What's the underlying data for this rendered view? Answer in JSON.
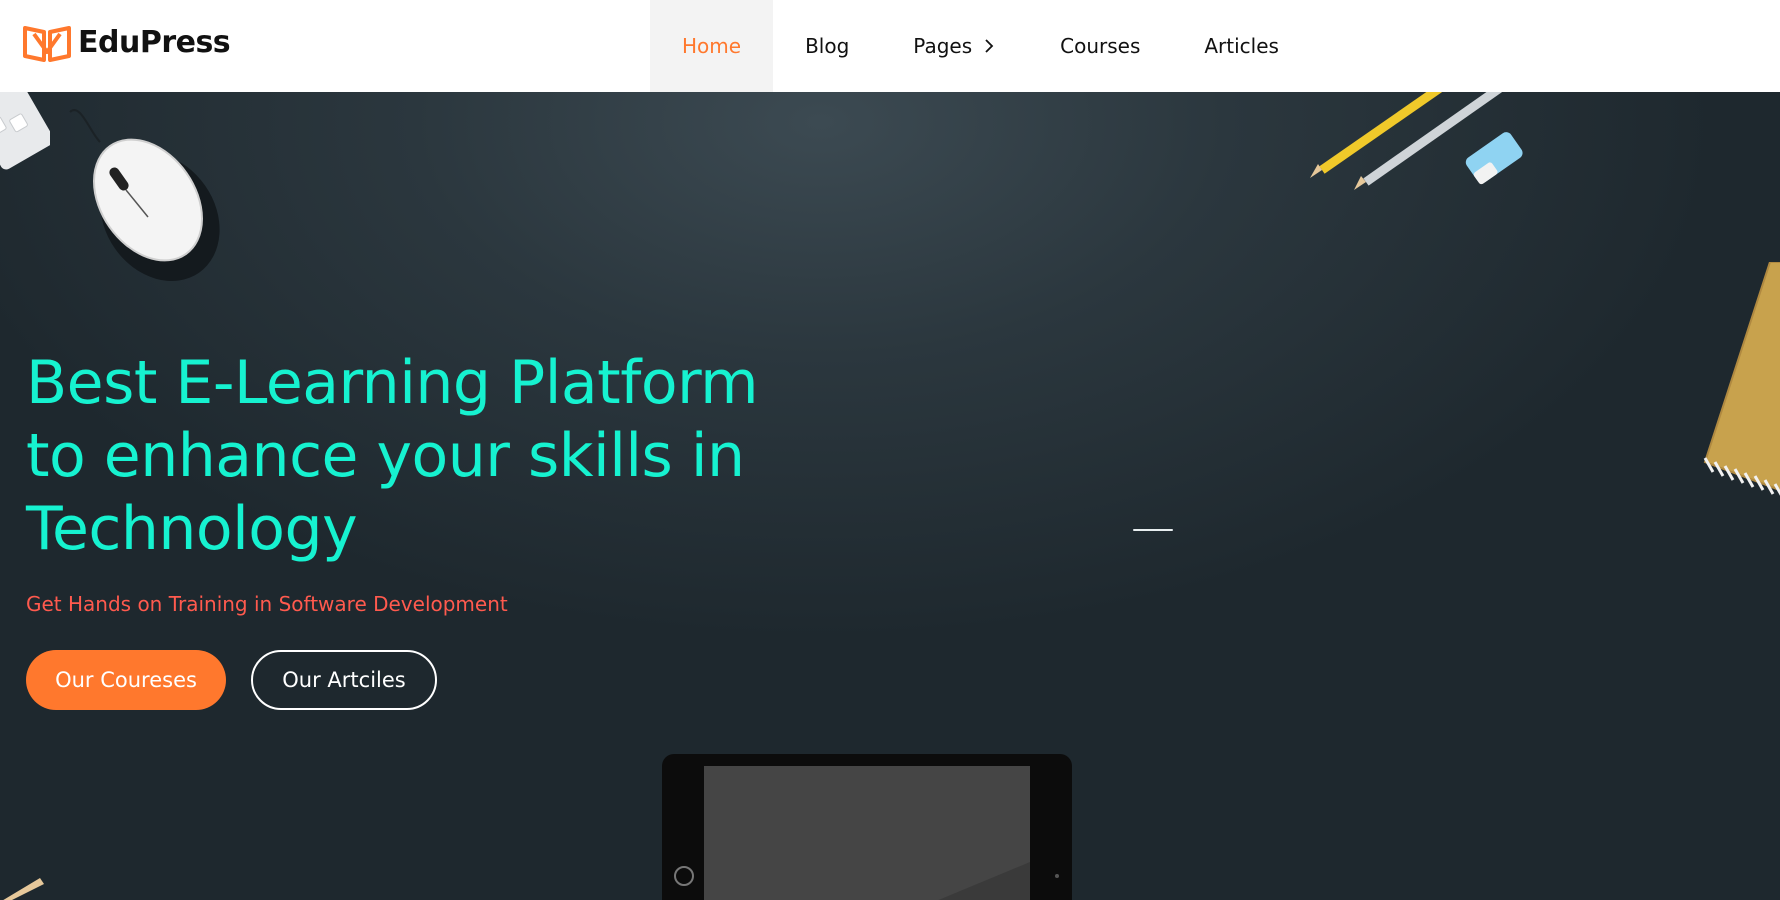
{
  "header": {
    "logo_text": "EduPress",
    "nav": [
      {
        "label": "Home",
        "active": true
      },
      {
        "label": "Blog"
      },
      {
        "label": "Pages"
      },
      {
        "label": "Courses"
      },
      {
        "label": "Articles"
      }
    ]
  },
  "hero": {
    "title": "Best E-Learning Platform to enhance your skills in Technology",
    "subtitle": "Get Hands on Training in Software Development",
    "primary_button": "Our Coureses",
    "secondary_button": "Our Artciles"
  },
  "colors": {
    "accent": "#ff782d",
    "title": "#16f2d0",
    "subtitle": "#ff5a4e",
    "hero_bg": "#2b373e"
  },
  "icons": [
    "logo-book-icon",
    "chevron-right-icon",
    "mouse-illustration",
    "pencil-illustration",
    "eraser-illustration",
    "notebook-illustration",
    "tablet-illustration",
    "keyboard-illustration"
  ]
}
